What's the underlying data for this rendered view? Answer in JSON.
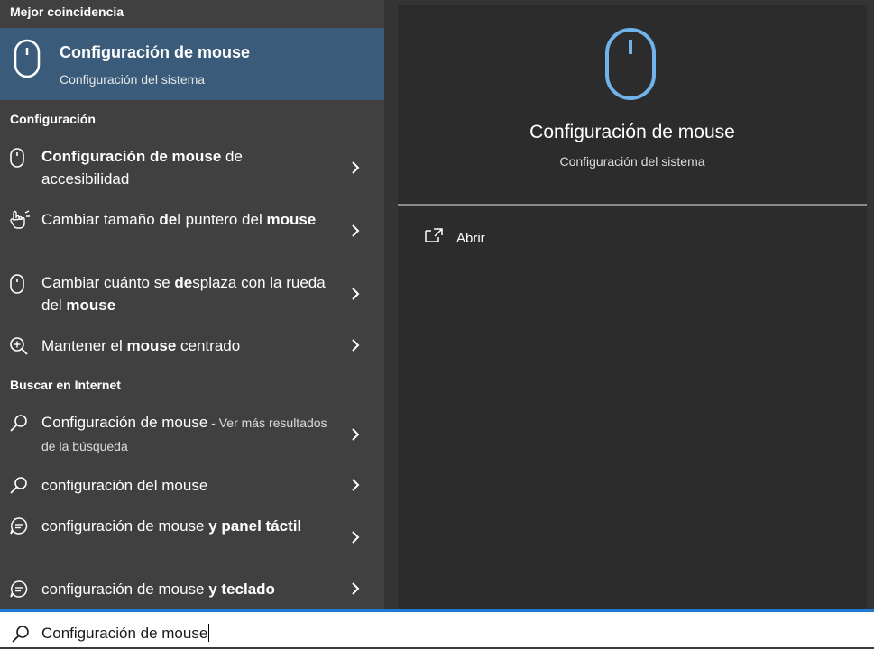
{
  "left": {
    "best_match_header": "Mejor coincidencia",
    "best_match": {
      "title": "Configuración de mouse",
      "subtitle": "Configuración del sistema",
      "icon": "mouse-icon"
    },
    "settings_header": "Configuración",
    "settings_items": [
      {
        "parts": [
          {
            "t": "Configuración de mouse",
            "b": true
          },
          {
            "t": " de accesibilidad",
            "b": false
          }
        ],
        "icon": "mouse-icon"
      },
      {
        "parts": [
          {
            "t": "Cambiar tamaño ",
            "b": false
          },
          {
            "t": "del",
            "b": true
          },
          {
            "t": " puntero del ",
            "b": false
          },
          {
            "t": "mouse",
            "b": true
          }
        ],
        "icon": "pointer-hand-icon"
      },
      {
        "parts": [
          {
            "t": "Cambiar cuánto se ",
            "b": false
          },
          {
            "t": "de",
            "b": true
          },
          {
            "t": "splaza con la rueda del ",
            "b": false
          },
          {
            "t": "mouse",
            "b": true
          }
        ],
        "icon": "mouse-icon"
      },
      {
        "parts": [
          {
            "t": "Mantener el ",
            "b": false
          },
          {
            "t": "mouse",
            "b": true
          },
          {
            "t": " centrado",
            "b": false
          }
        ],
        "icon": "magnifier-icon"
      }
    ],
    "web_header": "Buscar en Internet",
    "web_items": [
      {
        "parts": [
          {
            "t": "Configuración de mouse",
            "b": false
          }
        ],
        "suffix": " - Ver más resultados de la búsqueda",
        "icon": "search-icon"
      },
      {
        "parts": [
          {
            "t": "configuración del mouse",
            "b": false
          }
        ],
        "icon": "search-icon"
      },
      {
        "parts": [
          {
            "t": "configuración de mouse ",
            "b": false
          },
          {
            "t": "y panel táctil",
            "b": true
          }
        ],
        "icon": "chat-search-icon"
      },
      {
        "parts": [
          {
            "t": "configuración de mouse ",
            "b": false
          },
          {
            "t": "y teclado",
            "b": true
          }
        ],
        "icon": "chat-search-icon"
      }
    ]
  },
  "preview": {
    "title": "Configuración de mouse",
    "subtitle": "Configuración del sistema",
    "icon": "mouse-icon",
    "action_open": "Abrir",
    "action_open_icon": "open-external-icon"
  },
  "search": {
    "value": "Configuración de mouse",
    "icon": "search-icon"
  },
  "colors": {
    "accent": "#1e7bd1",
    "selected_bg": "#3a5c7a",
    "preview_icon": "#6fb3ea"
  }
}
